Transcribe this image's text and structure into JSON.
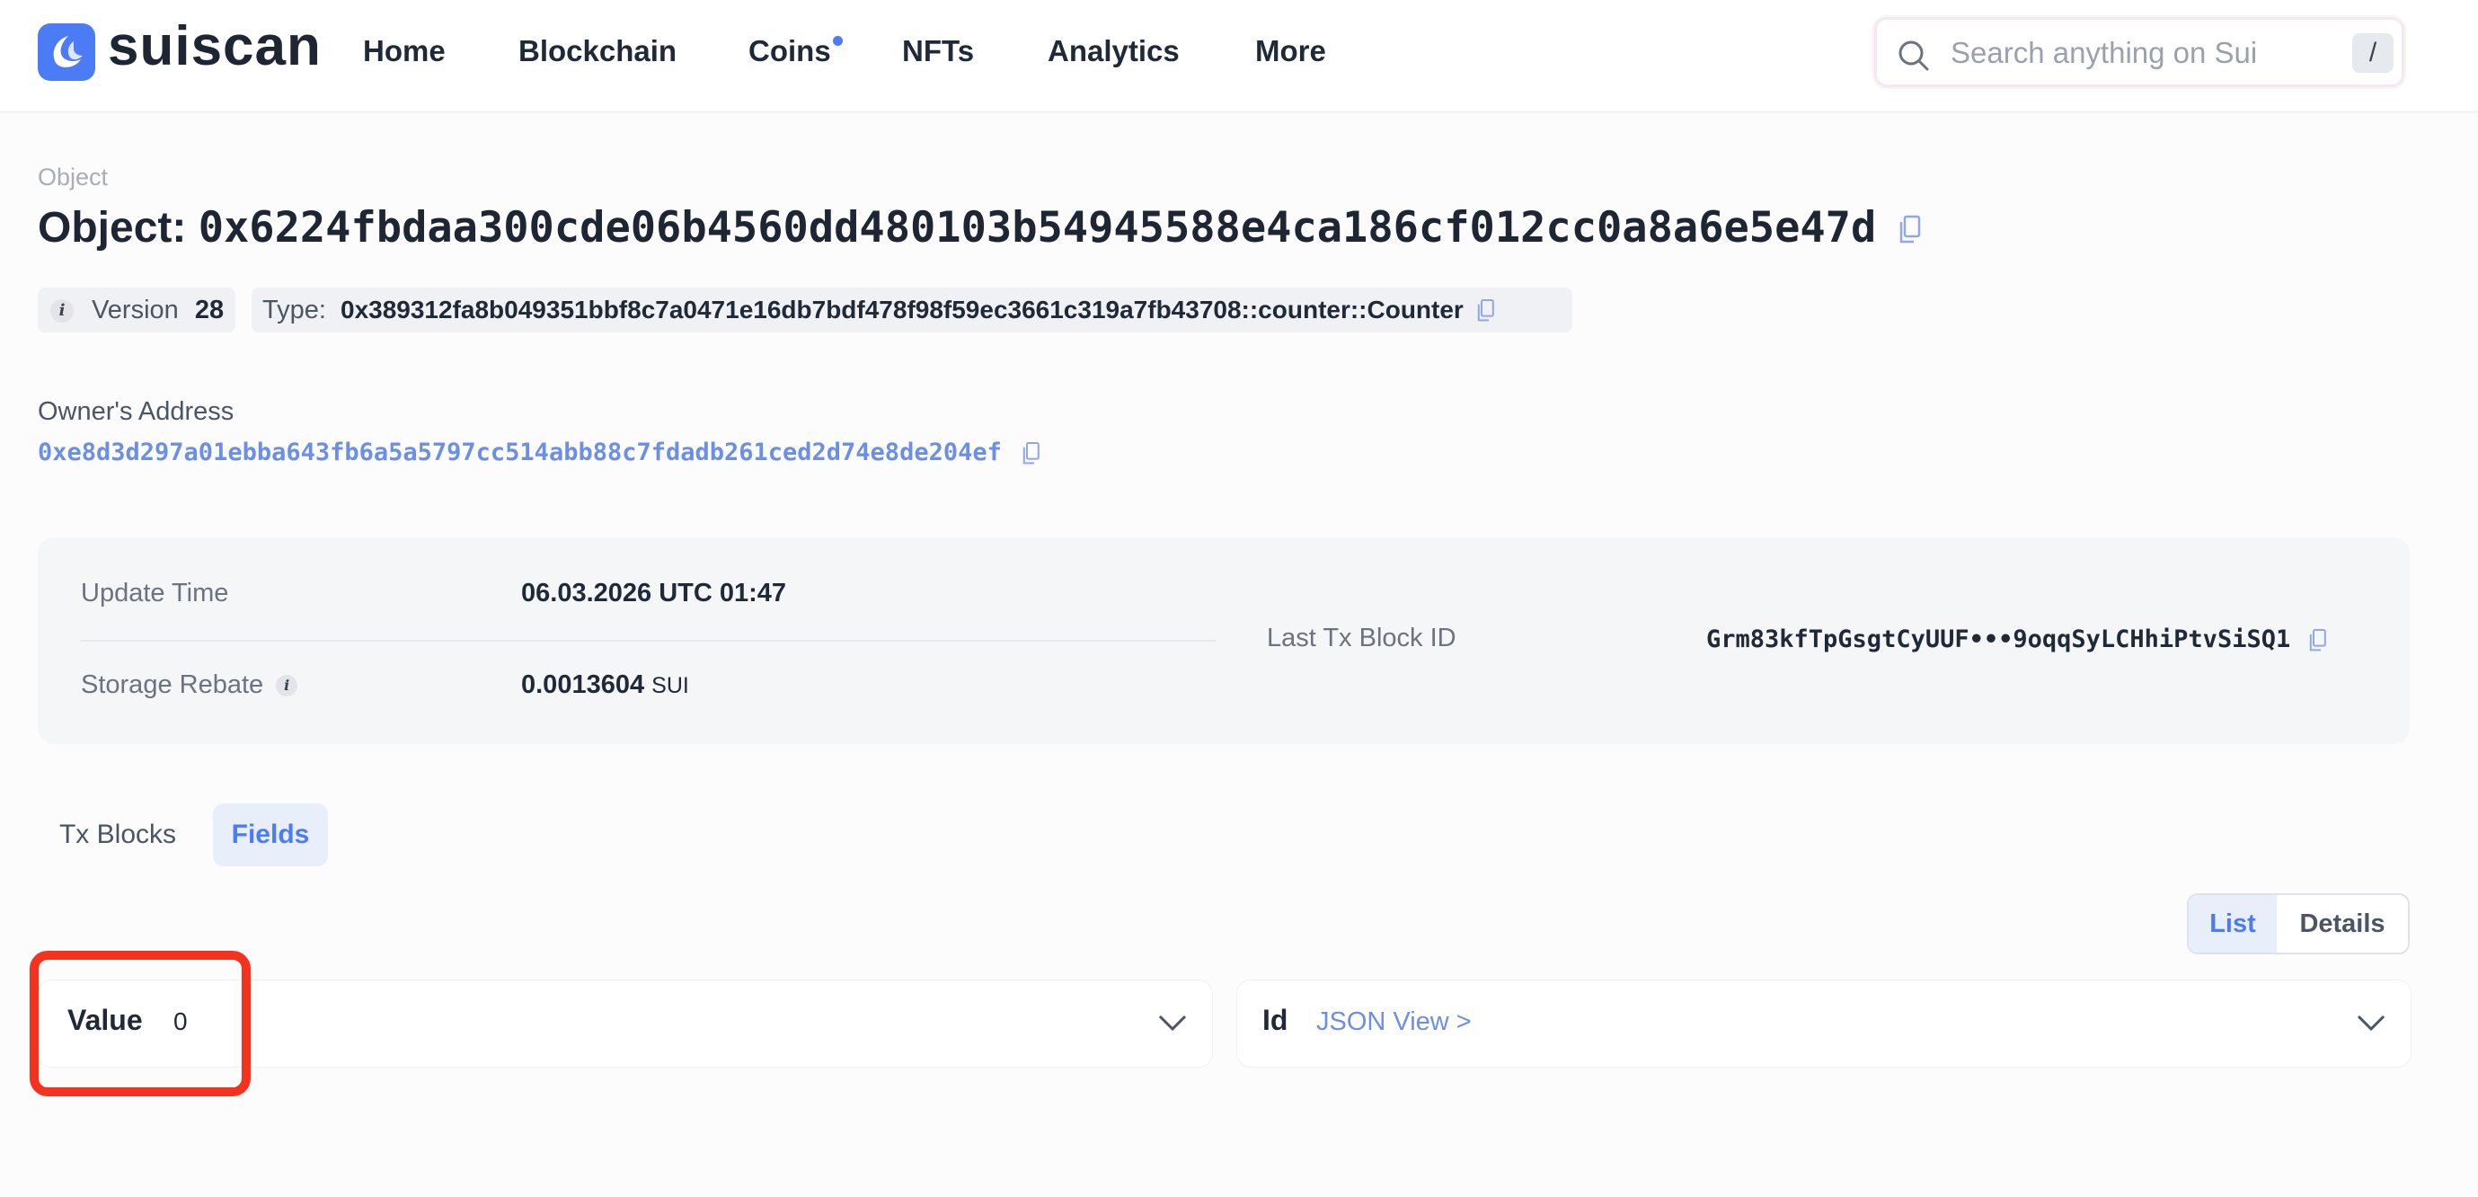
{
  "header": {
    "brand": "suiscan",
    "nav": [
      {
        "label": "Home"
      },
      {
        "label": "Blockchain"
      },
      {
        "label": "Coins",
        "dot": true
      },
      {
        "label": "NFTs"
      },
      {
        "label": "Analytics"
      },
      {
        "label": "More"
      }
    ],
    "search": {
      "placeholder": "Search anything on Sui",
      "shortcut": "/"
    }
  },
  "object": {
    "breadcrumb": "Object",
    "title_prefix": "Object:",
    "id": "0x6224fbdaa300cde06b4560dd480103b54945588e4ca186cf012cc0a8a6e5e47d",
    "version_label": "Version",
    "version": "28",
    "type_label": "Type:",
    "type": "0x389312fa8b049351bbf8c7a0471e16db7bdf478f98f59ec3661c319a7fb43708::counter::Counter",
    "owner_label": "Owner's Address",
    "owner": "0xe8d3d297a01ebba643fb6a5a5797cc514abb88c7fdadb261ced2d74e8de204ef"
  },
  "details": {
    "update_time_label": "Update Time",
    "update_time": "06.03.2026 UTC 01:47",
    "storage_rebate_label": "Storage Rebate",
    "storage_rebate": "0.0013604",
    "storage_rebate_unit": "SUI",
    "last_tx_label": "Last Tx Block ID",
    "last_tx": "Grm83kfTpGsgtCyUUF•••9oqqSyLCHhiPtvSiSQ1"
  },
  "tabs": [
    {
      "label": "Tx Blocks",
      "active": false
    },
    {
      "label": "Fields",
      "active": true
    }
  ],
  "view_toggle": {
    "list": "List",
    "details": "Details",
    "selected": "List"
  },
  "fields": [
    {
      "name": "Value",
      "value": "0"
    },
    {
      "name": "Id",
      "link": "JSON View >"
    }
  ],
  "colors": {
    "accent": "#4b7bf5",
    "link": "#6b8fe8",
    "highlight": "#f5321e"
  }
}
